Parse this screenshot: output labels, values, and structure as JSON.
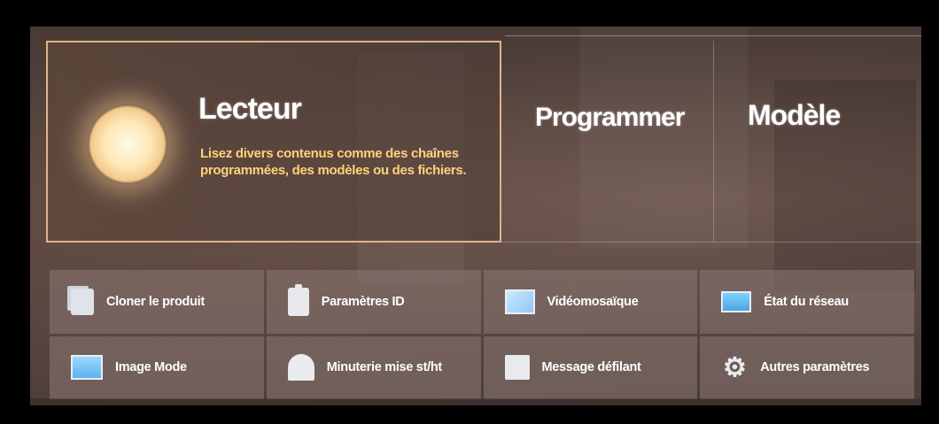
{
  "cards": {
    "lecteur": {
      "title": "Lecteur",
      "description": "Lisez divers contenus comme des chaînes programmées, des modèles ou des fichiers.",
      "icon": "sun-icon"
    },
    "programmer": {
      "title": "Programmer"
    },
    "modele": {
      "title": "Modèle"
    }
  },
  "tiles": [
    {
      "label": "Cloner le produit",
      "icon": "clone-icon"
    },
    {
      "label": "Paramètres ID",
      "icon": "id-icon"
    },
    {
      "label": "Vidéomosaïque",
      "icon": "video-wall-icon"
    },
    {
      "label": "État du réseau",
      "icon": "network-status-icon"
    },
    {
      "label": "Image Mode",
      "icon": "image-mode-icon"
    },
    {
      "label": "Minuterie mise st/ht",
      "icon": "timer-icon"
    },
    {
      "label": "Message défilant",
      "icon": "message-icon"
    },
    {
      "label": "Autres paramètres",
      "icon": "gear-icon"
    }
  ],
  "colors": {
    "accent_border": "#e0b487",
    "description_text": "#ffd27a"
  }
}
